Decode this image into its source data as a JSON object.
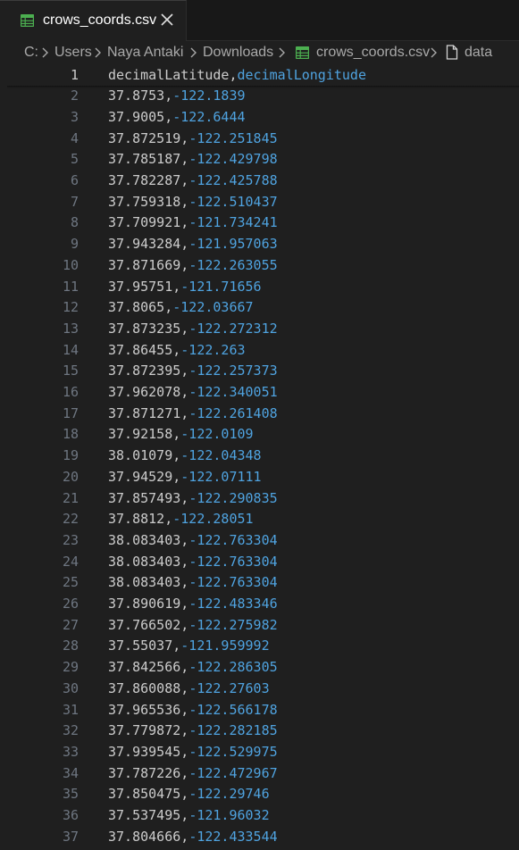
{
  "tab": {
    "filename": "crows_coords.csv",
    "icon": "csv-table-icon",
    "close_icon": "close-icon"
  },
  "breadcrumb": {
    "drive": "C:",
    "folders": [
      "Users",
      "Naya Antaki",
      "Downloads"
    ],
    "file": "crows_coords.csv",
    "symbol": "data"
  },
  "colors": {
    "column1": "#cccccc",
    "column2": "#4fa3e0",
    "line_number": "#6e7681",
    "active_line_number": "#cccccc",
    "csv_icon": "#4caf50"
  },
  "editor": {
    "active_line": 1,
    "lines": [
      {
        "n": "1",
        "a": "decimalLatitude",
        "b": "decimalLongitude"
      },
      {
        "n": "2",
        "a": "37.8753",
        "b": "-122.1839"
      },
      {
        "n": "3",
        "a": "37.9005",
        "b": "-122.6444"
      },
      {
        "n": "4",
        "a": "37.872519",
        "b": "-122.251845"
      },
      {
        "n": "5",
        "a": "37.785187",
        "b": "-122.429798"
      },
      {
        "n": "6",
        "a": "37.782287",
        "b": "-122.425788"
      },
      {
        "n": "7",
        "a": "37.759318",
        "b": "-122.510437"
      },
      {
        "n": "8",
        "a": "37.709921",
        "b": "-121.734241"
      },
      {
        "n": "9",
        "a": "37.943284",
        "b": "-121.957063"
      },
      {
        "n": "10",
        "a": "37.871669",
        "b": "-122.263055"
      },
      {
        "n": "11",
        "a": "37.95751",
        "b": "-121.71656"
      },
      {
        "n": "12",
        "a": "37.8065",
        "b": "-122.03667"
      },
      {
        "n": "13",
        "a": "37.873235",
        "b": "-122.272312"
      },
      {
        "n": "14",
        "a": "37.86455",
        "b": "-122.263"
      },
      {
        "n": "15",
        "a": "37.872395",
        "b": "-122.257373"
      },
      {
        "n": "16",
        "a": "37.962078",
        "b": "-122.340051"
      },
      {
        "n": "17",
        "a": "37.871271",
        "b": "-122.261408"
      },
      {
        "n": "18",
        "a": "37.92158",
        "b": "-122.0109"
      },
      {
        "n": "19",
        "a": "38.01079",
        "b": "-122.04348"
      },
      {
        "n": "20",
        "a": "37.94529",
        "b": "-122.07111"
      },
      {
        "n": "21",
        "a": "37.857493",
        "b": "-122.290835"
      },
      {
        "n": "22",
        "a": "37.8812",
        "b": "-122.28051"
      },
      {
        "n": "23",
        "a": "38.083403",
        "b": "-122.763304"
      },
      {
        "n": "24",
        "a": "38.083403",
        "b": "-122.763304"
      },
      {
        "n": "25",
        "a": "38.083403",
        "b": "-122.763304"
      },
      {
        "n": "26",
        "a": "37.890619",
        "b": "-122.483346"
      },
      {
        "n": "27",
        "a": "37.766502",
        "b": "-122.275982"
      },
      {
        "n": "28",
        "a": "37.55037",
        "b": "-121.959992"
      },
      {
        "n": "29",
        "a": "37.842566",
        "b": "-122.286305"
      },
      {
        "n": "30",
        "a": "37.860088",
        "b": "-122.27603"
      },
      {
        "n": "31",
        "a": "37.965536",
        "b": "-122.566178"
      },
      {
        "n": "32",
        "a": "37.779872",
        "b": "-122.282185"
      },
      {
        "n": "33",
        "a": "37.939545",
        "b": "-122.529975"
      },
      {
        "n": "34",
        "a": "37.787226",
        "b": "-122.472967"
      },
      {
        "n": "35",
        "a": "37.850475",
        "b": "-122.29746"
      },
      {
        "n": "36",
        "a": "37.537495",
        "b": "-121.96032"
      },
      {
        "n": "37",
        "a": "37.804666",
        "b": "-122.433544"
      }
    ]
  }
}
